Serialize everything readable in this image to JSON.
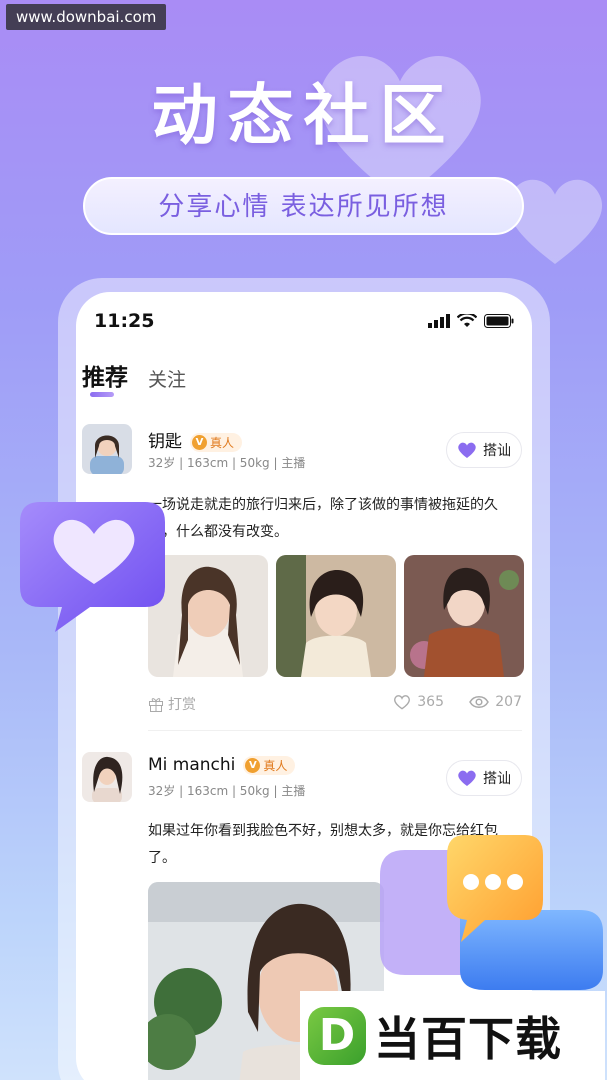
{
  "watermark": "www.downbai.com",
  "hero": {
    "title": "动态社区",
    "subtitle": "分享心情  表达所见所想"
  },
  "status_bar": {
    "time": "11:25"
  },
  "tabs": [
    {
      "label": "推荐",
      "active": true
    },
    {
      "label": "关注",
      "active": false
    }
  ],
  "posts": [
    {
      "name": "钥匙",
      "verified_label": "真人",
      "meta": "32岁 | 163cm | 50kg | 主播",
      "greet_label": "搭讪",
      "text": "一场说走就走的旅行归来后，除了该做的事情被拖延的久了，什么都没有改变。",
      "reward_label": "打赏",
      "likes": "365",
      "views": "207"
    },
    {
      "name": "Mi manchi",
      "verified_label": "真人",
      "meta": "32岁 | 163cm | 50kg | 主播",
      "greet_label": "搭讪",
      "text": "如果过年你看到我脸色不好，别想太多，就是你忘给红包了。"
    }
  ],
  "brand": {
    "letter": "D",
    "name": "当百下载"
  },
  "colors": {
    "accent": "#8b6cf0",
    "verified": "#e07a1e",
    "brand_green": "#3aa02c"
  }
}
